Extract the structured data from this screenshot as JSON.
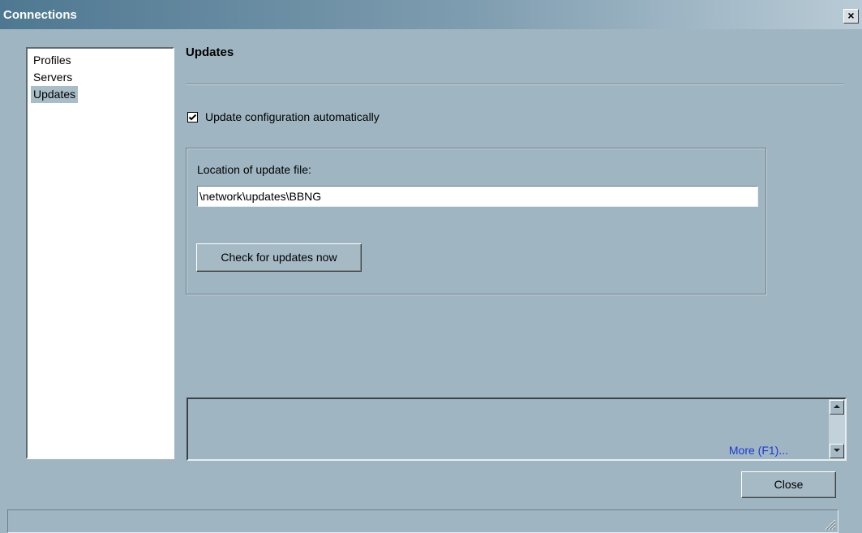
{
  "window": {
    "title": "Connections",
    "close_glyph": "×"
  },
  "sidebar": {
    "items": [
      {
        "label": "Profiles",
        "selected": false
      },
      {
        "label": "Servers",
        "selected": false
      },
      {
        "label": "Updates",
        "selected": true
      }
    ]
  },
  "main": {
    "section_title": "Updates",
    "auto_update": {
      "label": "Update configuration automatically",
      "checked": true
    },
    "location": {
      "label": "Location of update file:",
      "value": "\\network\\updates\\BBNG"
    },
    "check_button": "Check for updates now"
  },
  "help": {
    "more_link": "More (F1)..."
  },
  "footer": {
    "close_button": "Close"
  },
  "icons": {
    "checkmark": "checkmark-icon",
    "scroll_up": "scroll-up-icon",
    "scroll_down": "scroll-down-icon",
    "resize_grip": "resize-grip-icon"
  },
  "colors": {
    "background": "#9fb6c2",
    "title_bar_start": "#4e7891",
    "link": "#1a39d6",
    "selection": "#a8bdc8"
  }
}
